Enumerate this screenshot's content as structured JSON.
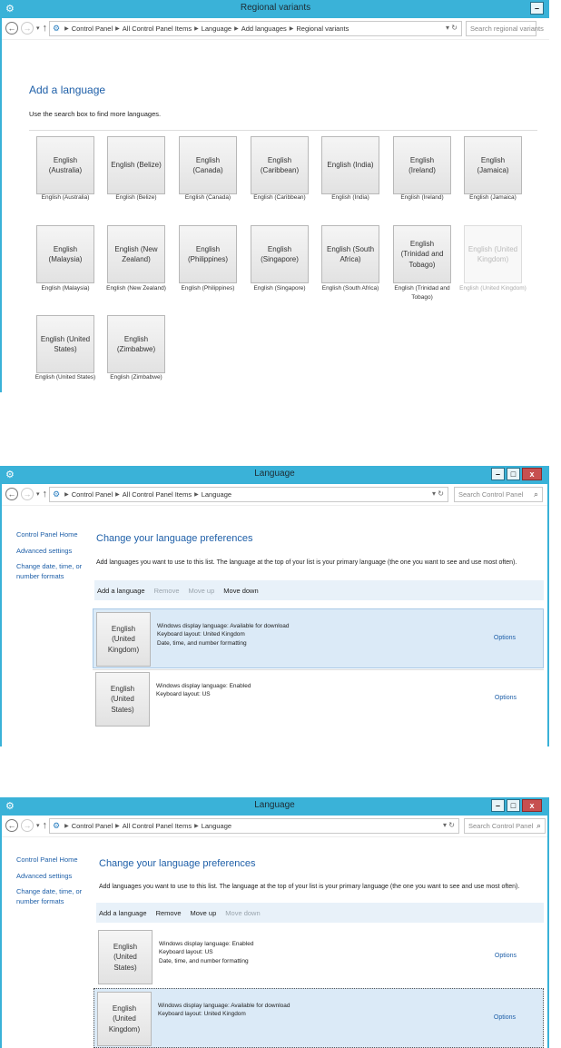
{
  "window1": {
    "title": "Regional variants",
    "addr": [
      "Control Panel",
      "All Control Panel Items",
      "Language",
      "Add languages",
      "Regional variants"
    ],
    "search_placeholder": "Search regional variants",
    "heading": "Add a language",
    "hint": "Use the search box to find more languages.",
    "tiles": [
      {
        "label": "English (Australia)",
        "caption": "English (Australia)",
        "disabled": false
      },
      {
        "label": "English (Belize)",
        "caption": "English (Belize)",
        "disabled": false
      },
      {
        "label": "English (Canada)",
        "caption": "English (Canada)",
        "disabled": false
      },
      {
        "label": "English (Caribbean)",
        "caption": "English (Caribbean)",
        "disabled": false
      },
      {
        "label": "English (India)",
        "caption": "English (India)",
        "disabled": false
      },
      {
        "label": "English (Ireland)",
        "caption": "English (Ireland)",
        "disabled": false
      },
      {
        "label": "English (Jamaica)",
        "caption": "English (Jamaica)",
        "disabled": false
      },
      {
        "label": "English (Malaysia)",
        "caption": "English (Malaysia)",
        "disabled": false
      },
      {
        "label": "English (New Zealand)",
        "caption": "English (New Zealand)",
        "disabled": false
      },
      {
        "label": "English (Philippines)",
        "caption": "English (Philippines)",
        "disabled": false
      },
      {
        "label": "English (Singapore)",
        "caption": "English (Singapore)",
        "disabled": false
      },
      {
        "label": "English (South Africa)",
        "caption": "English (South Africa)",
        "disabled": false
      },
      {
        "label": "English (Trinidad and Tobago)",
        "caption": "English (Trinidad and Tobago)",
        "disabled": false
      },
      {
        "label": "English (United Kingdom)",
        "caption": "English (United Kingdom)",
        "disabled": true
      },
      {
        "label": "English (United States)",
        "caption": "English (United States)",
        "disabled": false
      },
      {
        "label": "English (Zimbabwe)",
        "caption": "English (Zimbabwe)",
        "disabled": false
      }
    ]
  },
  "window2": {
    "title": "Language",
    "addr": [
      "Control Panel",
      "All Control Panel Items",
      "Language"
    ],
    "search_placeholder": "Search Control Panel",
    "sidebar": [
      "Control Panel Home",
      "Advanced settings",
      "Change date, time, or number formats"
    ],
    "heading": "Change your language preferences",
    "desc": "Add languages you want to use to this list. The language at the top of your list is your primary language (the one you want to see and use most often).",
    "toolbar": {
      "add": "Add a language",
      "remove": "Remove",
      "move_up": "Move up",
      "move_down": "Move down"
    },
    "rows": [
      {
        "tile": "English (United Kingdom)",
        "lines": [
          "Windows display language: Available for download",
          "Keyboard layout: United Kingdom",
          "Date, time, and number formatting"
        ],
        "options": "Options"
      },
      {
        "tile": "English (United States)",
        "lines": [
          "Windows display language: Enabled",
          "Keyboard layout: US"
        ],
        "options": "Options"
      }
    ]
  },
  "window3": {
    "title": "Language",
    "addr": [
      "Control Panel",
      "All Control Panel Items",
      "Language"
    ],
    "search_placeholder": "Search Control Panel",
    "sidebar": [
      "Control Panel Home",
      "Advanced settings",
      "Change date, time, or number formats"
    ],
    "heading": "Change your language preferences",
    "desc": "Add languages you want to use to this list. The language at the top of your list is your primary language (the one you want to see and use most often).",
    "toolbar": {
      "add": "Add a language",
      "remove": "Remove",
      "move_up": "Move up",
      "move_down": "Move down"
    },
    "rows": [
      {
        "tile": "English (United States)",
        "lines": [
          "Windows display language: Enabled",
          "Keyboard layout: US",
          "Date, time, and number formatting"
        ],
        "options": "Options"
      },
      {
        "tile": "English (United Kingdom)",
        "lines": [
          "Windows display language: Available for download",
          "Keyboard layout: United Kingdom"
        ],
        "options": "Options"
      }
    ]
  },
  "colors": {
    "titlebar": "#3ab2d8",
    "link": "#1e5fa8",
    "selection": "#dbeaf7",
    "close": "#c75050"
  }
}
